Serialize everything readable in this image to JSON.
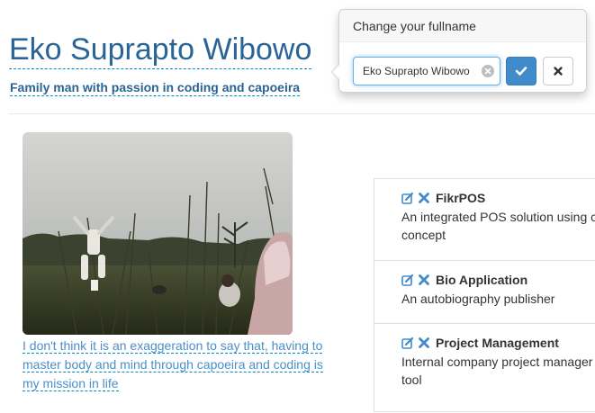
{
  "profile": {
    "fullname": "Eko Suprapto Wibowo",
    "tagline": "Family man with passion in coding and capoeira",
    "photo_caption": "I don't think it is an exaggeration to say that, having to master body and mind through capoeira and coding is my mission in life"
  },
  "popover": {
    "title": "Change your fullname",
    "input_value": "Eko Suprapto Wibowo",
    "submit_icon": "check-icon",
    "cancel_icon": "close-icon"
  },
  "projects": [
    {
      "name": "FikrPOS",
      "description": "An integrated POS solution using c\nconcept",
      "edit_icon": "edit-icon",
      "delete_icon": "delete-icon"
    },
    {
      "name": "Bio Application",
      "description": "An autobiography publisher",
      "edit_icon": "edit-icon",
      "delete_icon": "delete-icon"
    },
    {
      "name": "Project Management",
      "description": "Internal company project manager\ntool",
      "edit_icon": "edit-icon",
      "delete_icon": "delete-icon"
    }
  ],
  "colors": {
    "link": "#2a6496",
    "primary": "#428bca",
    "icon": "#428bca"
  }
}
